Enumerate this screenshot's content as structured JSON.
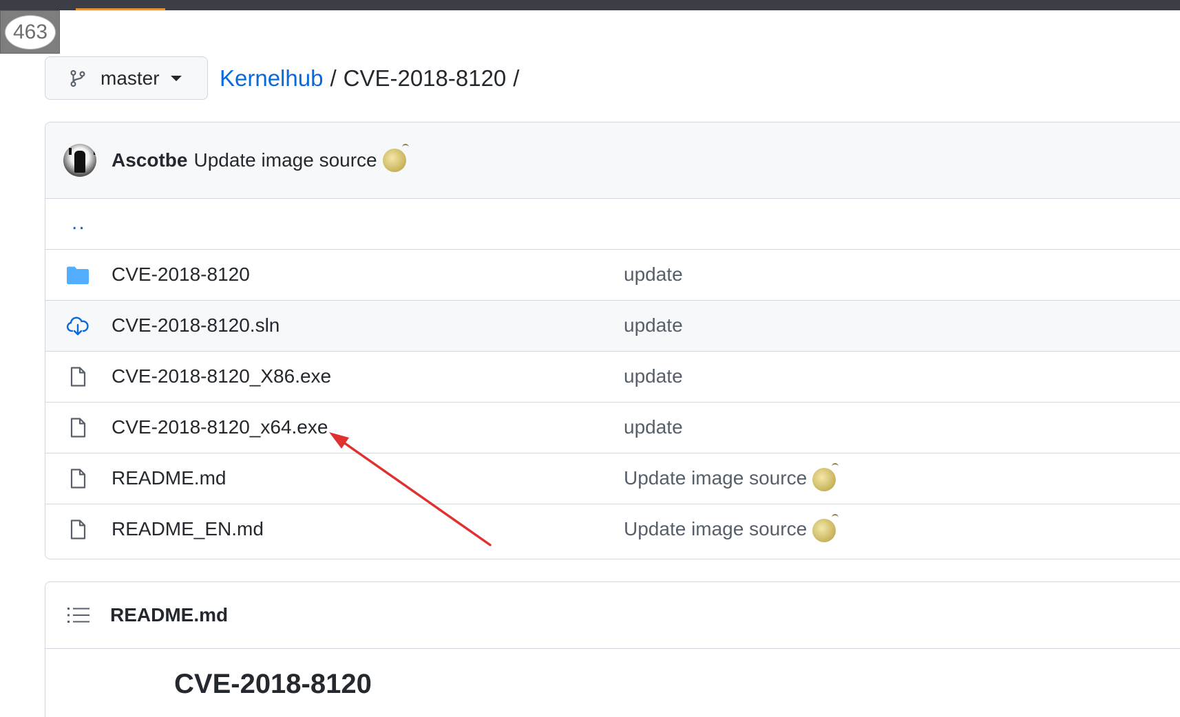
{
  "counter": {
    "value": "463"
  },
  "branch": {
    "label": "master"
  },
  "breadcrumb": {
    "repo": "Kernelhub",
    "separator": "/",
    "current": "CVE-2018-8120",
    "trailing": "/"
  },
  "latest_commit": {
    "author": "Ascotbe",
    "message": "Update image source"
  },
  "parent_dir": {
    "label": ".."
  },
  "files": [
    {
      "name": "CVE-2018-8120",
      "type": "folder",
      "commit": "update"
    },
    {
      "name": "CVE-2018-8120.sln",
      "type": "sln",
      "commit": "update"
    },
    {
      "name": "CVE-2018-8120_X86.exe",
      "type": "file",
      "commit": "update"
    },
    {
      "name": "CVE-2018-8120_x64.exe",
      "type": "file",
      "commit": "update"
    },
    {
      "name": "README.md",
      "type": "file",
      "commit": "Update image source"
    },
    {
      "name": "README_EN.md",
      "type": "file",
      "commit": "Update image source"
    }
  ],
  "readme": {
    "header": "README.md",
    "heading": "CVE-2018-8120"
  },
  "colors": {
    "link": "#0969da",
    "border": "#d0d7de",
    "annotation_arrow": "#e03131",
    "folder": "#54aeff"
  }
}
